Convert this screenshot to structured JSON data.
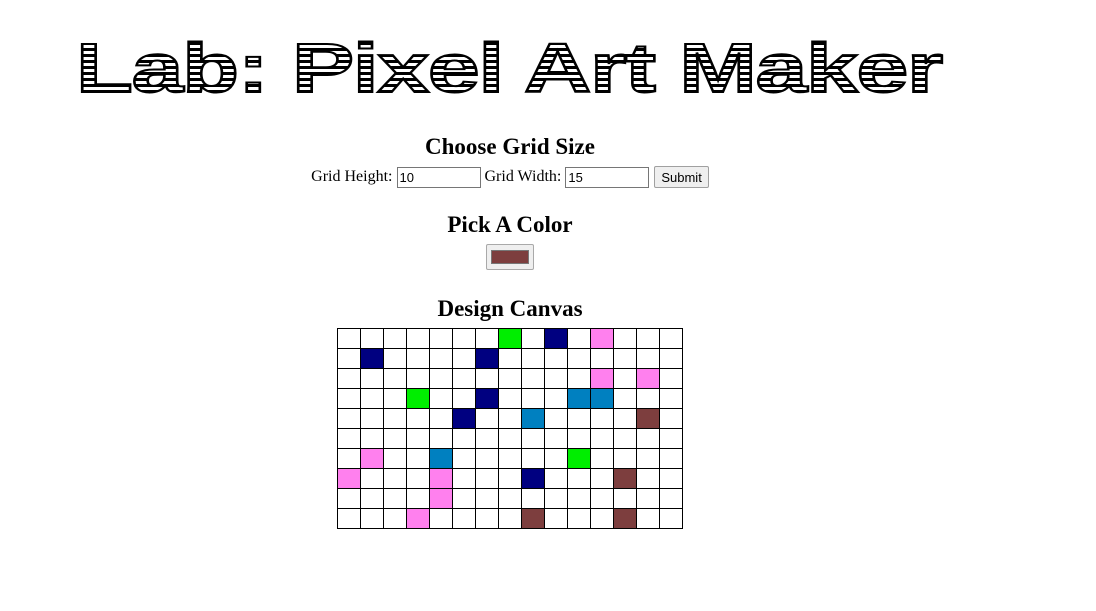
{
  "header": {
    "title": "Lab: Pixel Art Maker"
  },
  "grid_size": {
    "heading": "Choose Grid Size",
    "height_label": "Grid Height:",
    "height_value": "10",
    "width_label": "Grid Width:",
    "width_value": "15",
    "submit_label": "Submit"
  },
  "color_picker": {
    "heading": "Pick A Color",
    "selected_color": "#7d3e3e"
  },
  "design_canvas": {
    "heading": "Design Canvas",
    "rows": 10,
    "cols": 15,
    "palette": {
      "W": "#ffffff",
      "G": "#00ee00",
      "N": "#000080",
      "P": "#ff80ee",
      "B": "#0080c0",
      "R": "#7d3e3e"
    },
    "cells": [
      "WWWWWWWGWNWPWWW",
      "WNWWWWNWWWWWWWW",
      "WWWWWWWWWWWPWPW",
      "WWWGWWNWWWBBWWW",
      "WWWWWNWWBWWWWRW",
      "WWWWWWWWWWWWWWW",
      "WPWWBWWWWWGWWWW",
      "PWWWPWWWNWWWRWW",
      "WWWWPWWWWWWWWWW",
      "WWWPWWWWRWWWRWW"
    ]
  }
}
